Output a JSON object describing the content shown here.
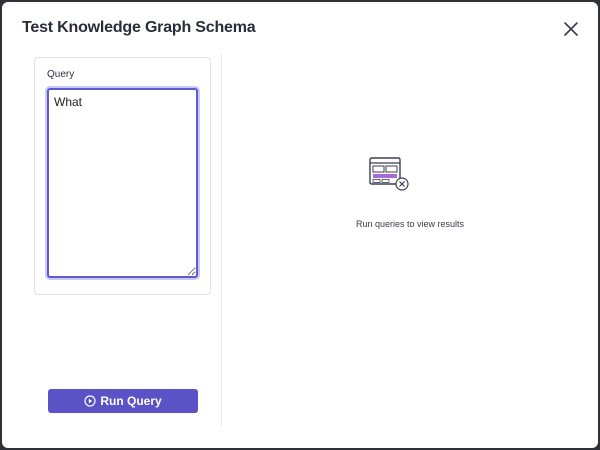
{
  "dialog": {
    "title": "Test Knowledge Graph Schema",
    "close_icon": "close-icon"
  },
  "query": {
    "label": "Query",
    "value": "What"
  },
  "run_button": {
    "label": "Run Query",
    "icon": "play-circle-icon"
  },
  "results": {
    "empty_icon": "empty-results-icon",
    "empty_text": "Run queries to view results"
  },
  "colors": {
    "accent": "#5b52c5",
    "focus_border": "#5b5bd6",
    "empty_icon_accent": "#a66ad8"
  }
}
